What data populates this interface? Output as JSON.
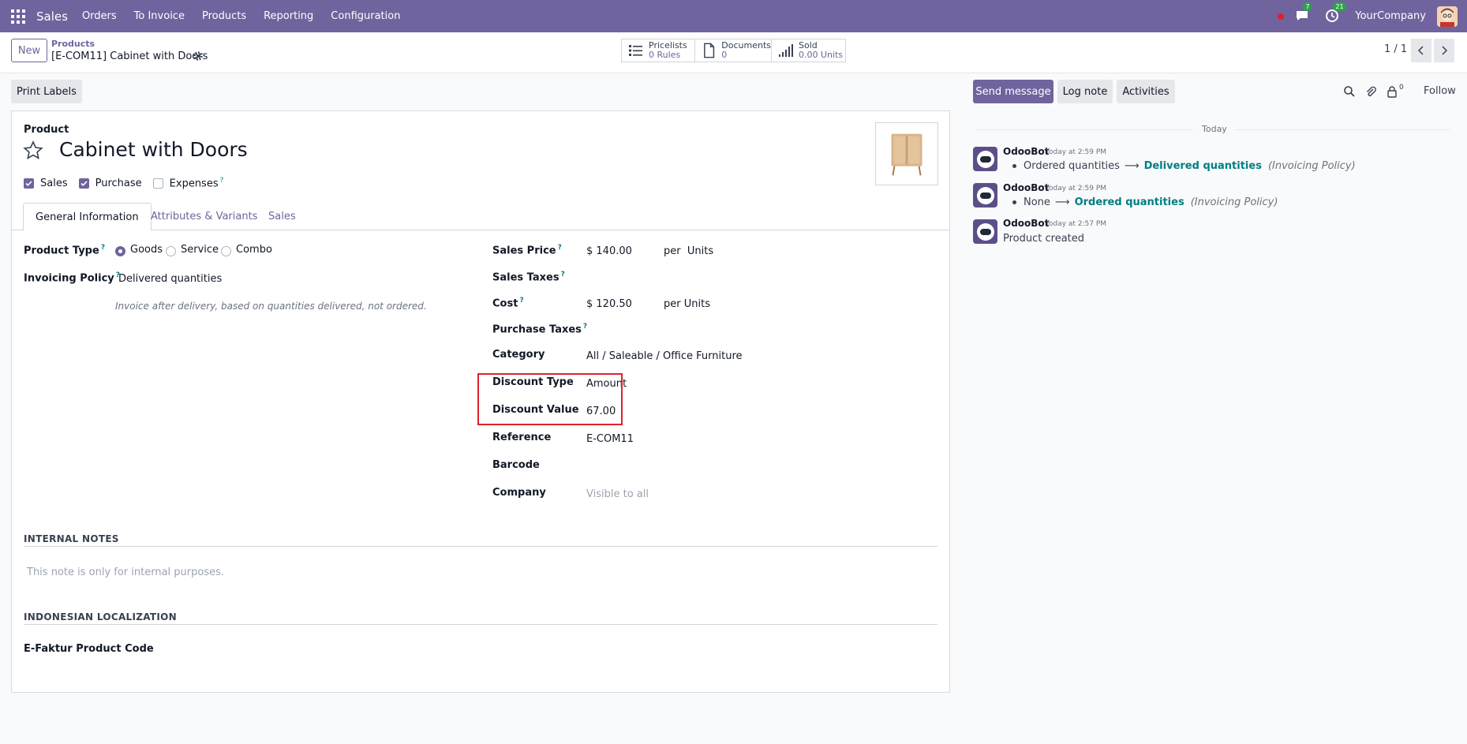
{
  "navbar": {
    "app_name": "Sales",
    "menu": [
      "Orders",
      "To Invoice",
      "Products",
      "Reporting",
      "Configuration"
    ],
    "messages_badge": "7",
    "activities_badge": "21",
    "company": "YourCompany"
  },
  "control": {
    "new_label": "New",
    "breadcrumb_parent": "Products",
    "breadcrumb_current": "[E-COM11] Cabinet with Doors",
    "smart_buttons": [
      {
        "title": "Pricelists",
        "value": "0 Rules",
        "icon": "list-icon"
      },
      {
        "title": "Documents",
        "value": "0",
        "icon": "document-icon"
      },
      {
        "title": "Sold",
        "value": "0.00 Units",
        "icon": "chart-icon"
      }
    ],
    "pager": "1 / 1"
  },
  "actions": {
    "print_labels": "Print Labels"
  },
  "form": {
    "section_label": "Product",
    "name": "Cabinet with Doors",
    "checkboxes": [
      {
        "label": "Sales",
        "checked": true
      },
      {
        "label": "Purchase",
        "checked": true
      },
      {
        "label": "Expenses",
        "checked": false
      }
    ],
    "help_mark": "?",
    "tabs": [
      "General Information",
      "Attributes & Variants",
      "Sales"
    ],
    "product_type": {
      "label": "Product Type",
      "options": [
        "Goods",
        "Service",
        "Combo"
      ],
      "selected": "Goods"
    },
    "invoicing_policy": {
      "label": "Invoicing Policy",
      "value": "Delivered quantities",
      "hint": "Invoice after delivery, based on quantities delivered, not ordered."
    },
    "sales_price": {
      "label": "Sales Price",
      "value": "$ 140.00",
      "unit": "per  Units"
    },
    "sales_taxes": {
      "label": "Sales Taxes"
    },
    "cost": {
      "label": "Cost",
      "value": "$ 120.50",
      "unit": "per Units"
    },
    "purchase_taxes": {
      "label": "Purchase Taxes"
    },
    "category": {
      "label": "Category",
      "value": "All / Saleable / Office Furniture"
    },
    "discount_type": {
      "label": "Discount Type",
      "value": "Amount"
    },
    "discount_value": {
      "label": "Discount Value",
      "value": "67.00"
    },
    "reference": {
      "label": "Reference",
      "value": "E-COM11"
    },
    "barcode": {
      "label": "Barcode"
    },
    "company": {
      "label": "Company",
      "placeholder": "Visible to all"
    },
    "internal_notes": {
      "title": "INTERNAL NOTES",
      "placeholder": "This note is only for internal purposes."
    },
    "localization": {
      "title": "INDONESIAN LOCALIZATION",
      "efaktur_label": "E-Faktur Product Code"
    }
  },
  "chatter": {
    "send_message": "Send message",
    "log_note": "Log note",
    "activities": "Activities",
    "followers_count": "0",
    "follow": "Follow",
    "date_separator": "Today",
    "messages": [
      {
        "author": "OdooBot",
        "time": "Today at 2:59 PM",
        "old": "Ordered quantities",
        "new": "Delivered quantities",
        "field": "(Invoicing Policy)"
      },
      {
        "author": "OdooBot",
        "time": "Today at 2:59 PM",
        "old": "None",
        "new": "Ordered quantities",
        "field": "(Invoicing Policy)"
      },
      {
        "author": "OdooBot",
        "time": "Today at 2:57 PM",
        "text": "Product created"
      }
    ],
    "arrow": "⟶"
  },
  "colors": {
    "brand": "#71639e",
    "link": "#017e84",
    "highlight": "#e0212b"
  }
}
